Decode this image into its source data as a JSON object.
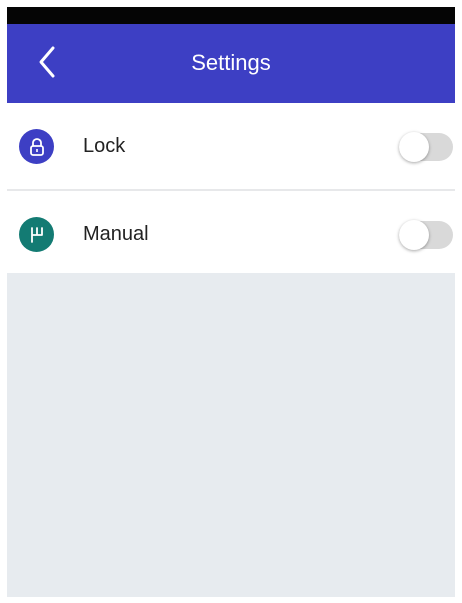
{
  "app_bar": {
    "title": "Settings",
    "back_icon": "chevron-left-icon",
    "color": "#3d3fc4"
  },
  "settings": [
    {
      "label": "Lock",
      "icon": "lock-icon",
      "icon_color": "#3d3fc4",
      "enabled": false
    },
    {
      "label": "Manual",
      "icon": "manual-gear-icon",
      "icon_color": "#137b73",
      "enabled": false
    }
  ],
  "colors": {
    "status_bar": "#050505",
    "content_background": "#e7ebef",
    "toggle_off": "#d9d9d9"
  }
}
